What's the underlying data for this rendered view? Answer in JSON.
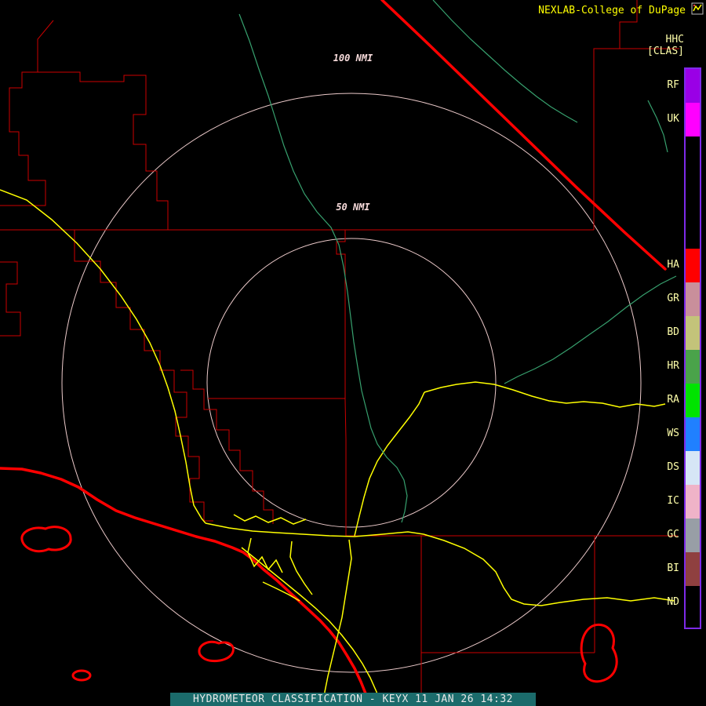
{
  "header": {
    "credit": "NEXLAB-College of DuPage"
  },
  "legend": {
    "product_code": "HHC",
    "mode": "[CLAS]",
    "items": [
      {
        "label": "RF",
        "color": "#9a00e6"
      },
      {
        "label": "UK",
        "color": "#ff00ff"
      },
      {
        "label": "HA",
        "color": "#ff0000"
      },
      {
        "label": "GR",
        "color": "#c98f9b"
      },
      {
        "label": "BD",
        "color": "#c3c37a"
      },
      {
        "label": "HR",
        "color": "#4aa34a"
      },
      {
        "label": "RA",
        "color": "#00e400"
      },
      {
        "label": "WS",
        "color": "#2080ff"
      },
      {
        "label": "DS",
        "color": "#d6e6f6"
      },
      {
        "label": "IC",
        "color": "#efb3c8"
      },
      {
        "label": "GC",
        "color": "#989ea6"
      },
      {
        "label": "BI",
        "color": "#8f4040"
      },
      {
        "label": "ND",
        "color": "#000000"
      }
    ]
  },
  "rings": [
    {
      "label": "100 NMI"
    },
    {
      "label": "50 NMI"
    }
  ],
  "map": {
    "colors": {
      "county_lines": "#cc0000",
      "emphasis": "#ff0000",
      "highways": "#ffff00",
      "rivers": "#37a06e",
      "range_rings": "#eccaca",
      "ring_label": "#f6dada"
    }
  },
  "footer": {
    "status": "HYDROMETEOR CLASSIFICATION - KEYX 11 JAN 26 14:32"
  }
}
